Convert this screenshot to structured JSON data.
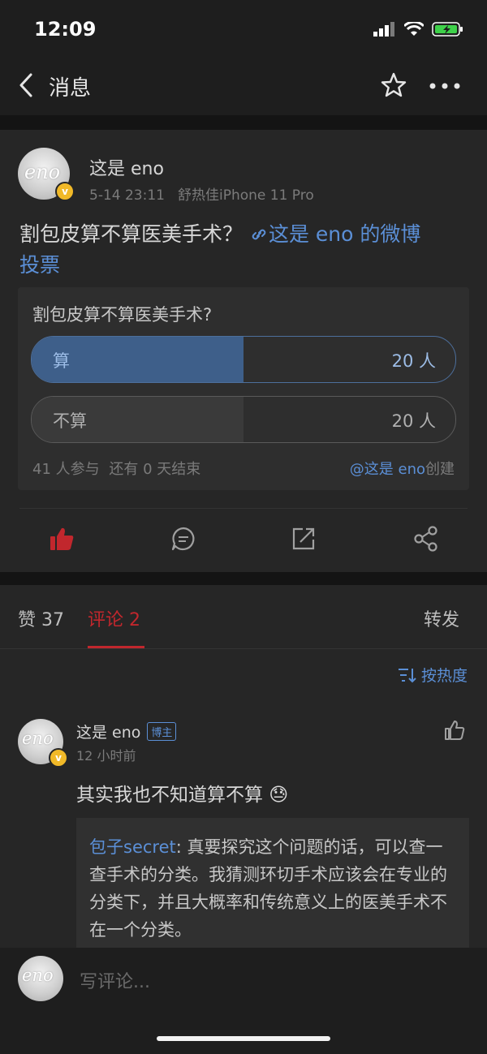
{
  "status_bar": {
    "time": "12:09"
  },
  "nav": {
    "title": "消息"
  },
  "post": {
    "author": "这是 eno",
    "date": "5-14 23:11",
    "source": "舒热佳iPhone 11 Pro",
    "text_before": "割包皮算不算医美手术？",
    "link_text": "这是 eno 的微博",
    "link_text2": "投票",
    "avatar_text": "eno"
  },
  "vote": {
    "question": "割包皮算不算医美手术?",
    "options": [
      {
        "label": "算",
        "count": "20 人",
        "share": 0.5,
        "selected": true
      },
      {
        "label": "不算",
        "count": "20 人",
        "share": 0.5,
        "selected": false
      }
    ],
    "footer_participants": "41 人参与",
    "footer_remaining": "还有 0 天结束",
    "creator_link": "@这是 eno",
    "creator_suffix": "创建"
  },
  "tabs": {
    "likes": "赞 37",
    "comments": "评论 2",
    "reposts": "转发"
  },
  "sort_label": "按热度",
  "comment": {
    "author": "这是 eno",
    "badge": "博主",
    "time": "12 小时前",
    "text": "其实我也不知道算不算 😓",
    "reply_author": "包子secret",
    "reply_text": ": 真要探究这个问题的话，可以查一查手术的分类。我猜测环切手术应该会在专业的分类下，并且大概率和传统意义上的医美手术不在一个分类。"
  },
  "input": {
    "placeholder": "写评论..."
  },
  "colors": {
    "accent_red": "#c1272d",
    "link_blue": "#5b8fd6",
    "vote_fill": "#3e5f8a",
    "vote_fill_alt": "#3a3a3a"
  }
}
